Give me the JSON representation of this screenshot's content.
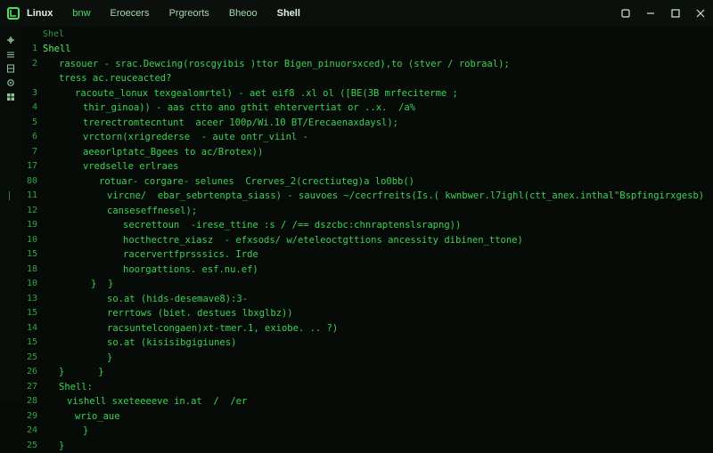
{
  "titlebar": {
    "app_name": "Linux",
    "menu": [
      "bnw",
      "Eroecers",
      "Prgreorts",
      "Bheoo",
      "Shell"
    ]
  },
  "activity_icons": [
    "move-icon",
    "list-icon",
    "files-icon",
    "settings-icon",
    "extensions-icon"
  ],
  "editor": {
    "tab": "Shel",
    "lines": [
      {
        "n": "1",
        "text": "Shell",
        "indent": 0
      },
      {
        "n": "2",
        "text": "rasouer - srac.Dewcing(roscgyibis )ttor Bigen_pinuorsxced),to (stver / robraal);",
        "indent": 2
      },
      {
        "n": "",
        "text": "tress ac.reuceacted?",
        "indent": 2
      },
      {
        "n": "3",
        "text": "racoute_lonux texgealomrtel) - aet eif8 .xl ol ([BE(3B mrfeciterme ;",
        "indent": 4
      },
      {
        "n": "4",
        "text": "thir_ginoa)) - aas ctto ano gthit ehtervertiat or ..x.  /a%",
        "indent": 5
      },
      {
        "n": "5",
        "text": "trerectromtecntunt  aceer 100p/Wi.10 BT/Erecaenaxdaysl);",
        "indent": 5
      },
      {
        "n": "6",
        "text": "vrctorn(xrigrederse  - aute ontr_viinl -",
        "indent": 5
      },
      {
        "n": "7",
        "text": "aeeorlptatc_Bgees to ac/Brotex))",
        "indent": 5
      },
      {
        "n": "17",
        "text": "vredselle erlraes",
        "indent": 5
      },
      {
        "n": "80",
        "text": "rotuar- corgare- selunes  Crerves_2(crectiuteg)a lo0bb()",
        "indent": 7
      },
      {
        "n": "11",
        "text": "vircne/  ebar_sebrtenpta_siass) - sauvoes ~/cecrfreits(Is.( kwnbwer.l7ighl(ctt_anex.inthal\"Bspfingirxgesb)",
        "indent": 8
      },
      {
        "n": "12",
        "text": "canseseffnesel);",
        "indent": 8
      },
      {
        "n": "19",
        "text": "secrettoun  -irese_ttine :s / /== dszcbc:chnraptenslsrapng))",
        "indent": 10
      },
      {
        "n": "10",
        "text": "hocthectre_xiasz  - efxsods/ w/eteleoctgttions ancessity dibinen_ttone)",
        "indent": 10
      },
      {
        "n": "15",
        "text": "racervertfprsssics. Irde",
        "indent": 10
      },
      {
        "n": "18",
        "text": "hoorgattions. esf.nu.ef)",
        "indent": 10
      },
      {
        "n": "10",
        "text": "}  }",
        "indent": 6
      },
      {
        "n": "13",
        "text": "so.at (hids-desemave8):3-",
        "indent": 8
      },
      {
        "n": "15",
        "text": "rerrtows (biet. destues lbxglbz))",
        "indent": 8
      },
      {
        "n": "14",
        "text": "racsuntelcongaen)xt-tmer.1, exiobe. .. ?)",
        "indent": 8
      },
      {
        "n": "15",
        "text": "so.at (kisisibgigiunes)",
        "indent": 8
      },
      {
        "n": "25",
        "text": "}",
        "indent": 8
      },
      {
        "n": "26",
        "text": "}      }",
        "indent": 2
      },
      {
        "n": "27",
        "text": "Shell:",
        "indent": 2
      },
      {
        "n": "28",
        "text": "vishell sxeteeeeve in.at  /  /er",
        "indent": 3
      },
      {
        "n": "29",
        "text": "wrio_aue",
        "indent": 4
      },
      {
        "n": "24",
        "text": "}",
        "indent": 5
      },
      {
        "n": "25",
        "text": "}",
        "indent": 2
      }
    ]
  },
  "colors": {
    "background": "#070b08",
    "titlebar": "#0b100c",
    "code_text": "#39d353",
    "line_number": "#2da743",
    "accent": "#4be061"
  }
}
